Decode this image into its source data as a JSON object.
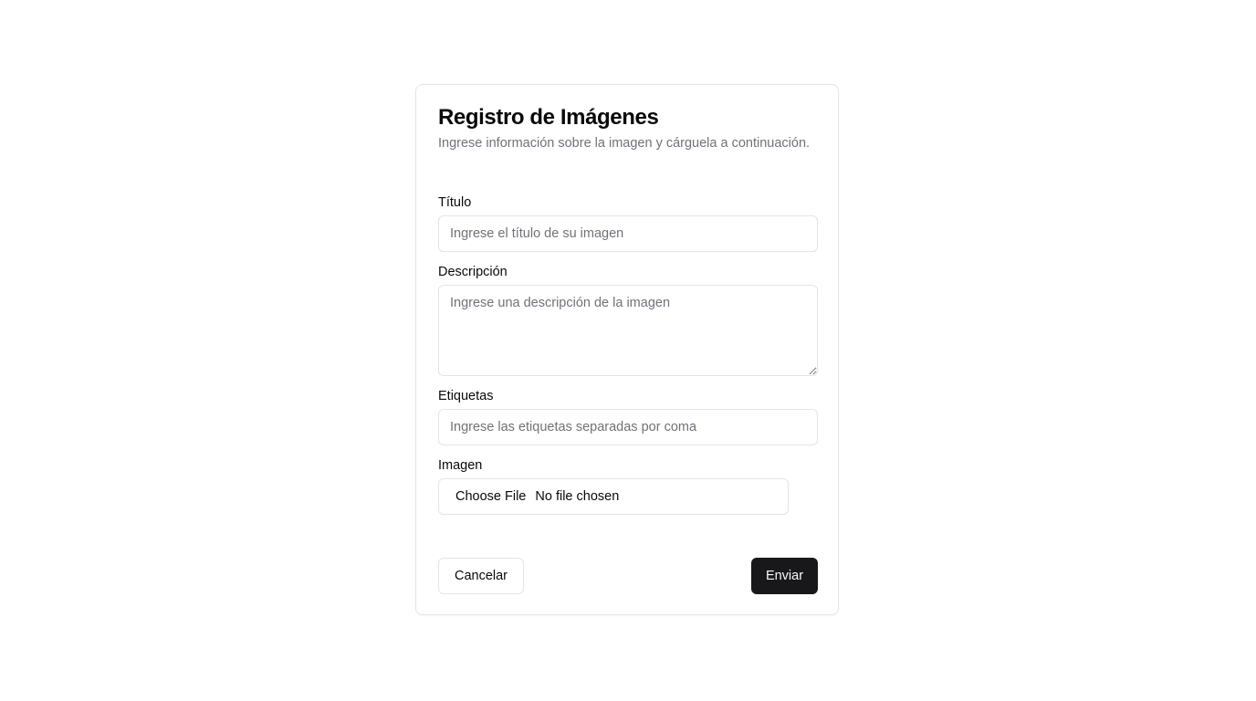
{
  "card": {
    "title": "Registro de Imágenes",
    "description": "Ingrese información sobre la imagen y cárguela a continuación."
  },
  "form": {
    "title_field": {
      "label": "Título",
      "value": "",
      "placeholder": "Ingrese el título de su imagen"
    },
    "description_field": {
      "label": "Descripción",
      "value": "",
      "placeholder": "Ingrese una descripción de la imagen"
    },
    "tags_field": {
      "label": "Etiquetas",
      "value": "",
      "placeholder": "Ingrese las etiquetas separadas por coma"
    },
    "image_field": {
      "label": "Imagen",
      "button_label": "Choose File",
      "status": "No file chosen"
    }
  },
  "actions": {
    "cancel_label": "Cancelar",
    "submit_label": "Enviar"
  },
  "colors": {
    "primary": "#18181b",
    "border": "#e4e4e7",
    "muted_text": "#71717a"
  }
}
